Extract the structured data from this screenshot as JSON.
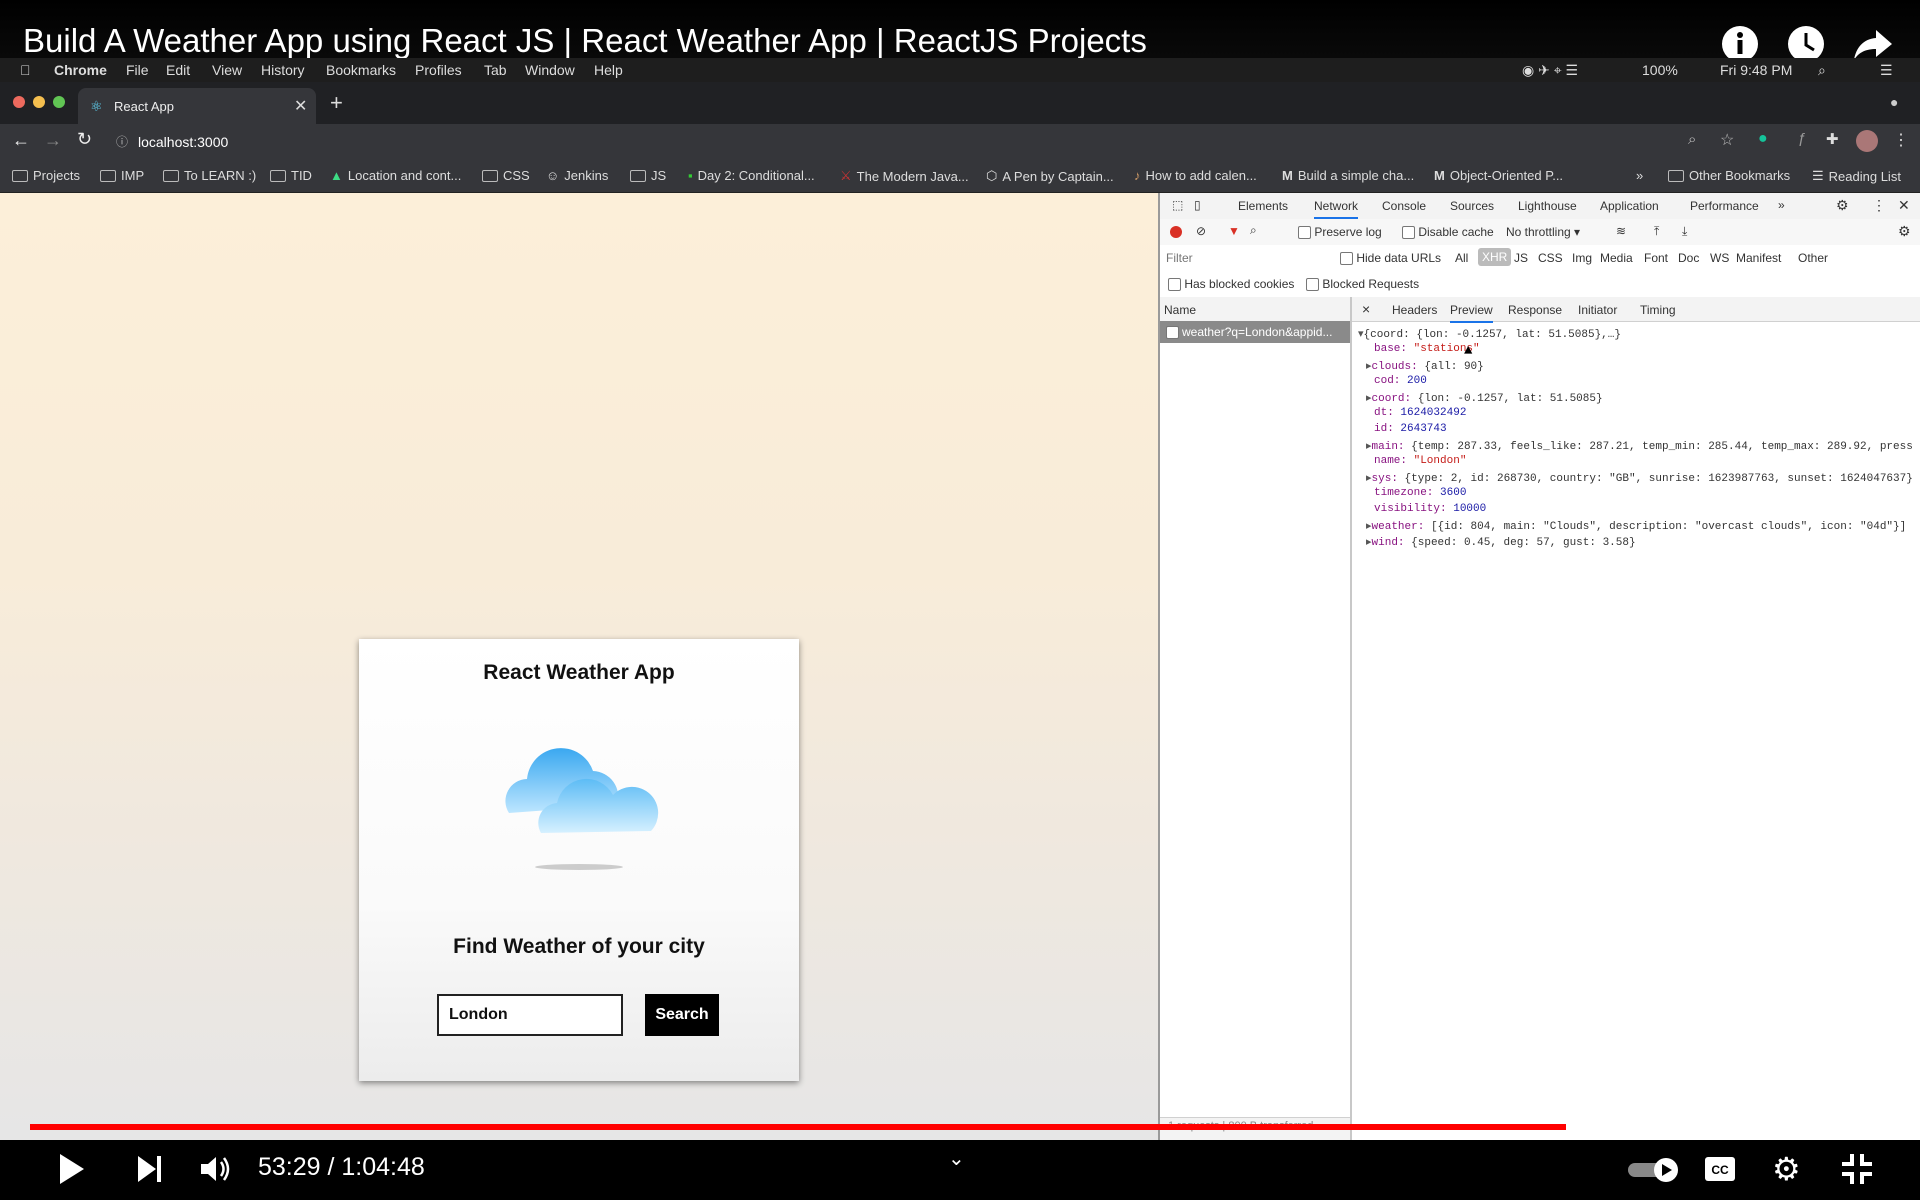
{
  "video": {
    "title": "Build A Weather App using React JS | React Weather App | ReactJS Projects",
    "time_current": "53:29",
    "time_total": "1:04:48",
    "time_display": "53:29 / 1:04:48",
    "progress": 0.8257,
    "buffered": 0.868
  },
  "mac_menu": {
    "items": [
      "Chrome",
      "File",
      "Edit",
      "View",
      "History",
      "Bookmarks",
      "Profiles",
      "Tab",
      "Window",
      "Help"
    ],
    "battery": "100%",
    "clock": "Fri 9:48 PM"
  },
  "browser": {
    "tab_title": "React App",
    "url": "localhost:3000",
    "bookmarks": [
      "Projects",
      "IMP",
      "To LEARN :)",
      "TID",
      "Location and cont...",
      "CSS",
      "Jenkins",
      "JS",
      "Day 2: Conditional...",
      "The Modern Java...",
      "A Pen by Captain...",
      "How to add calen...",
      "Build a simple cha...",
      "Object-Oriented P..."
    ],
    "other_bookmarks": "Other Bookmarks",
    "reading_list": "Reading List",
    "overflow": "»"
  },
  "app": {
    "title": "React Weather App",
    "subtitle": "Find Weather of your city",
    "input_value": "London",
    "search_label": "Search"
  },
  "devtools": {
    "tabs": [
      "Elements",
      "Network",
      "Console",
      "Sources",
      "Lighthouse",
      "Application",
      "Performance"
    ],
    "more": "»",
    "preserve_log": "Preserve log",
    "disable_cache": "Disable cache",
    "throttling": "No throttling",
    "filter_placeholder": "Filter",
    "hide_data_urls": "Hide data URLs",
    "filter_types": [
      "All",
      "XHR",
      "JS",
      "CSS",
      "Img",
      "Media",
      "Font",
      "Doc",
      "WS",
      "Manifest",
      "Other"
    ],
    "has_blocked_cookies": "Has blocked cookies",
    "blocked_requests": "Blocked Requests",
    "name_header": "Name",
    "request_name": "weather?q=London&appid...",
    "detail_tabs": [
      "Headers",
      "Preview",
      "Response",
      "Initiator",
      "Timing"
    ],
    "close": "×",
    "footer": "1 requests | 800 B transferred",
    "preview": {
      "root": "{coord: {lon: -0.1257, lat: 51.5085},…}",
      "lines": [
        {
          "key": "base",
          "value": "\"stations\"",
          "kind": "str",
          "expand": false
        },
        {
          "key": "clouds",
          "value": "{all: 90}",
          "kind": "obj",
          "expand": true
        },
        {
          "key": "cod",
          "value": "200",
          "kind": "num",
          "expand": false
        },
        {
          "key": "coord",
          "value": "{lon: -0.1257, lat: 51.5085}",
          "kind": "obj",
          "expand": true
        },
        {
          "key": "dt",
          "value": "1624032492",
          "kind": "num",
          "expand": false
        },
        {
          "key": "id",
          "value": "2643743",
          "kind": "num",
          "expand": false
        },
        {
          "key": "main",
          "value": "{temp: 287.33, feels_like: 287.21, temp_min: 285.44, temp_max: 289.92, press",
          "kind": "obj",
          "expand": true
        },
        {
          "key": "name",
          "value": "\"London\"",
          "kind": "str",
          "expand": false
        },
        {
          "key": "sys",
          "value": "{type: 2, id: 268730, country: \"GB\", sunrise: 1623987763, sunset: 1624047637}",
          "kind": "obj",
          "expand": true
        },
        {
          "key": "timezone",
          "value": "3600",
          "kind": "num",
          "expand": false
        },
        {
          "key": "visibility",
          "value": "10000",
          "kind": "num",
          "expand": false
        },
        {
          "key": "weather",
          "value": "[{id: 804, main: \"Clouds\", description: \"overcast clouds\", icon: \"04d\"}]",
          "kind": "obj",
          "expand": true
        },
        {
          "key": "wind",
          "value": "{speed: 0.45, deg: 57, gust: 3.58}",
          "kind": "obj",
          "expand": true
        }
      ]
    }
  },
  "colors": {
    "progress": "#ff0000",
    "record": "#d93025",
    "active_tab": "#1a73e8"
  }
}
